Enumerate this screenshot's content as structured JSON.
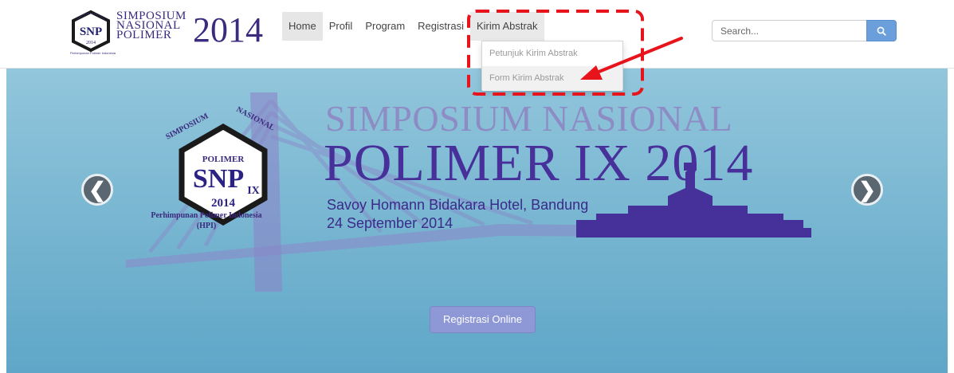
{
  "brand": {
    "abbr": "SNP",
    "line1": "SIMPOSIUM",
    "line2": "NASIONAL",
    "line3": "POLIMER",
    "year": "2014",
    "caption": "Perhimpunan Polimer Indonesia"
  },
  "nav": {
    "items": [
      {
        "label": "Home",
        "active": true
      },
      {
        "label": "Profil"
      },
      {
        "label": "Program"
      },
      {
        "label": "Registrasi"
      },
      {
        "label": "Kirim Abstrak",
        "open": true
      }
    ],
    "dropdown": [
      {
        "label": "Petunjuk Kirim Abstrak"
      },
      {
        "label": "Form Kirim Abstrak",
        "hover": true
      }
    ]
  },
  "search": {
    "placeholder": "Search...",
    "icon": "search-icon"
  },
  "hero": {
    "logo": {
      "arc_left": "SIMPOSIUM",
      "arc_right": "NASIONAL",
      "top": "POLIMER",
      "abbr": "SNP",
      "roman": "IX",
      "year": "2014",
      "org_line1": "Perhimpunan Polimer Indonesia",
      "org_line2": "(HPI)"
    },
    "title_line1": "SIMPOSIUM NASIONAL",
    "title_line2": "POLIMER IX 2014",
    "venue": "Savoy Homann Bidakara Hotel, Bandung",
    "date": "24 September 2014",
    "prev_icon": "❮",
    "next_icon": "❯",
    "cta_label": "Registrasi Online"
  },
  "colors": {
    "brand_purple": "#3b2a7d",
    "annotation_red": "#e8141c",
    "search_button": "#6a9fdc",
    "cta_button": "#8e98d6",
    "hero_sky": "#7db9d3"
  }
}
